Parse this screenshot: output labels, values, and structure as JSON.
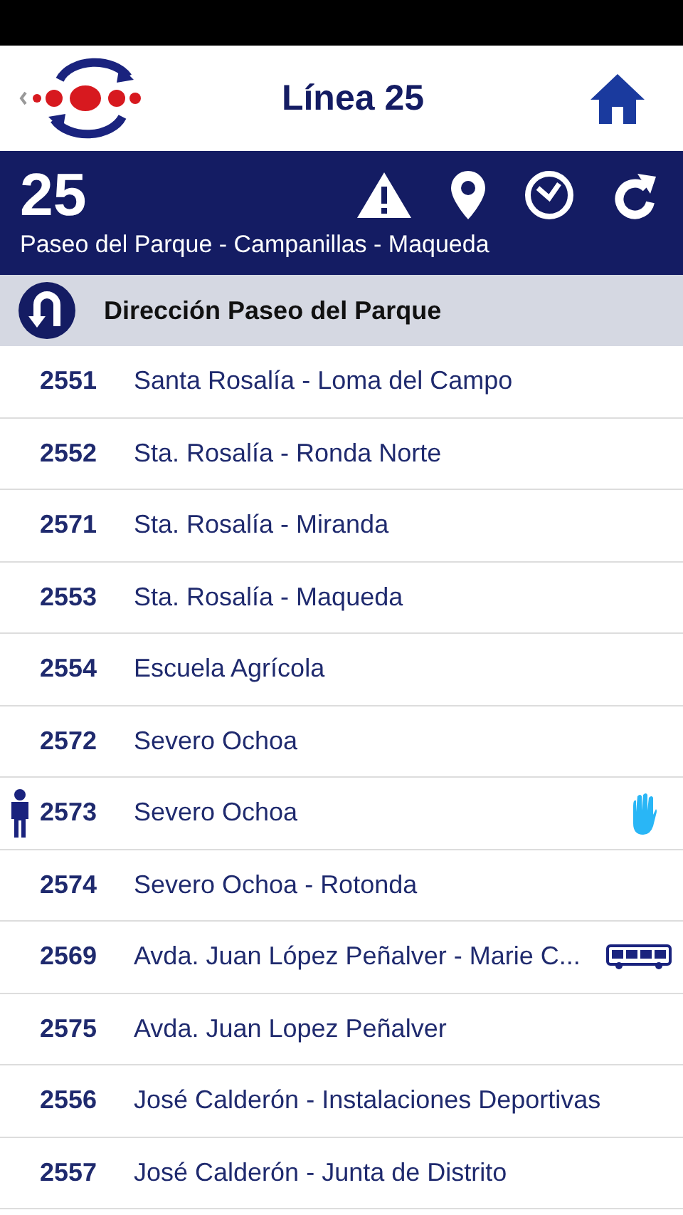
{
  "header": {
    "title": "Línea 25"
  },
  "line": {
    "number": "25",
    "route": "Paseo del Parque - Campanillas - Maqueda"
  },
  "direction": {
    "label": "Dirección Paseo del Parque"
  },
  "stops": [
    {
      "code": "2551",
      "name": "Santa Rosalía - Loma del Campo",
      "you_are_here": false,
      "request_stop": false,
      "bus_here": false
    },
    {
      "code": "2552",
      "name": "Sta. Rosalía - Ronda Norte",
      "you_are_here": false,
      "request_stop": false,
      "bus_here": false
    },
    {
      "code": "2571",
      "name": "Sta. Rosalía - Miranda",
      "you_are_here": false,
      "request_stop": false,
      "bus_here": false
    },
    {
      "code": "2553",
      "name": "Sta. Rosalía - Maqueda",
      "you_are_here": false,
      "request_stop": false,
      "bus_here": false
    },
    {
      "code": "2554",
      "name": "Escuela Agrícola",
      "you_are_here": false,
      "request_stop": false,
      "bus_here": false
    },
    {
      "code": "2572",
      "name": "Severo Ochoa",
      "you_are_here": false,
      "request_stop": false,
      "bus_here": false
    },
    {
      "code": "2573",
      "name": "Severo Ochoa",
      "you_are_here": true,
      "request_stop": true,
      "bus_here": false
    },
    {
      "code": "2574",
      "name": "Severo Ochoa - Rotonda",
      "you_are_here": false,
      "request_stop": false,
      "bus_here": false
    },
    {
      "code": "2569",
      "name": "Avda. Juan López Peñalver - Marie C...",
      "you_are_here": false,
      "request_stop": false,
      "bus_here": true
    },
    {
      "code": "2575",
      "name": "Avda. Juan Lopez Peñalver",
      "you_are_here": false,
      "request_stop": false,
      "bus_here": false
    },
    {
      "code": "2556",
      "name": "José Calderón - Instalaciones Deportivas",
      "you_are_here": false,
      "request_stop": false,
      "bus_here": false
    },
    {
      "code": "2557",
      "name": "José Calderón - Junta de Distrito",
      "you_are_here": false,
      "request_stop": false,
      "bus_here": false
    }
  ]
}
